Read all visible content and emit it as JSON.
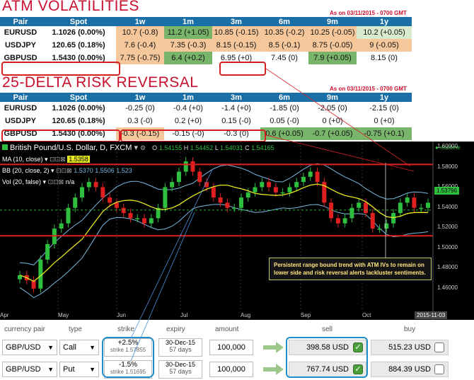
{
  "atm": {
    "title": "ATM VOLATILITIES",
    "asof": "As on 03/11/2015 - 0700 GMT",
    "headers": [
      "Pair",
      "Spot",
      "1w",
      "1m",
      "3m",
      "6m",
      "9m",
      "1y"
    ],
    "rows": [
      {
        "pair": "EURUSD",
        "spot": "1.1026 (0.00%)",
        "cells": [
          [
            "10.7 (-0.8)",
            "o"
          ],
          [
            "11.2 (+1.05)",
            "g"
          ],
          [
            "10.85 (-0.15)",
            "o"
          ],
          [
            "10.35 (-0.2)",
            "o"
          ],
          [
            "10.25 (-0.05)",
            "o"
          ],
          [
            "10.2 (+0.05)",
            "lg"
          ]
        ]
      },
      {
        "pair": "USDJPY",
        "spot": "120.65 (0.18%)",
        "cells": [
          [
            "7.6 (-0.4)",
            "o"
          ],
          [
            "7.35 (-0.3)",
            "o"
          ],
          [
            "8.15 (-0.15)",
            "o"
          ],
          [
            "8.5 (-0.1)",
            "o"
          ],
          [
            "8.75 (-0.05)",
            "o"
          ],
          [
            "9 (-0.05)",
            "o"
          ]
        ]
      },
      {
        "pair": "GBPUSD",
        "spot": "1.5430 (0.00%)",
        "cells": [
          [
            "7.75 (-0.75)",
            "o"
          ],
          [
            "6.4 (+0.2)",
            "g"
          ],
          [
            "6.95 (+0)",
            "w"
          ],
          [
            "7.45 (0)",
            "w"
          ],
          [
            "7.9 (+0.05)",
            "g"
          ],
          [
            "8.15 (0)",
            "w"
          ]
        ]
      }
    ]
  },
  "rr": {
    "title": "25-DELTA RISK REVERSAL",
    "asof": "As on 03/11/2015 - 0700 GMT",
    "headers": [
      "Pair",
      "Spot",
      "1w",
      "1m",
      "3m",
      "6m",
      "9m",
      "1y"
    ],
    "rows": [
      {
        "pair": "EURUSD",
        "spot": "1.1026 (0.00%)",
        "cells": [
          [
            "-0.25 (0)",
            "w"
          ],
          [
            "-0.4 (+0)",
            "w"
          ],
          [
            "-1.4 (+0)",
            "w"
          ],
          [
            "-1.85 (0)",
            "w"
          ],
          [
            "-2.05 (0)",
            "w"
          ],
          [
            "-2.15 (0)",
            "w"
          ]
        ]
      },
      {
        "pair": "USDJPY",
        "spot": "120.65 (0.18%)",
        "cells": [
          [
            "0.3 (-0)",
            "w"
          ],
          [
            "0.2 (+0)",
            "w"
          ],
          [
            "0.15 (-0)",
            "w"
          ],
          [
            "0.05 (-0)",
            "w"
          ],
          [
            "0 (+0)",
            "w"
          ],
          [
            "0 (+0)",
            "w"
          ]
        ]
      },
      {
        "pair": "GBPUSD",
        "spot": "1.5430 (0.00%)",
        "cells": [
          [
            "-0.3 (-0.15)",
            "o"
          ],
          [
            "-0.15 (-0)",
            "w"
          ],
          [
            "-0.3 (0)",
            "w"
          ],
          [
            "0.6 (+0.05)",
            "g"
          ],
          [
            "-0.7 (+0.05)",
            "g"
          ],
          [
            "-0.75 (+0.1)",
            "g"
          ]
        ]
      }
    ]
  },
  "chart": {
    "title": "British Pound/U.S. Dollar, D, FXCM",
    "ohlc": {
      "o_label": "O",
      "o": "1.54155",
      "h_label": "H",
      "h": "1.54452",
      "l_label": "L",
      "l": "1.54031",
      "c_label": "C",
      "c": "1.54165"
    },
    "realtime": "realtime",
    "ind1": "MA (10, close)",
    "ind1_val": "1.5358",
    "ind2": "BB (20, close, 2)",
    "ind2_vals": "1.5370  1.5506  1.523",
    "ind3": "Vol (20, false)",
    "ind3_val": "n/a",
    "yticks": [
      "1.60000",
      "1.58000",
      "1.56000",
      "1.54000",
      "1.52000",
      "1.50000",
      "1.48000",
      "1.46000"
    ],
    "last_price": "1.53796",
    "xticks": [
      "Apr",
      "May",
      "Jun",
      "Jul",
      "Aug",
      "Sep",
      "Oct"
    ],
    "date_label": "2015-11-03",
    "annotation": "Persistent range bound trend with ATM IVs to remain on lower side and risk reversal alerts lackluster sentiments."
  },
  "chart_data": {
    "type": "candlestick",
    "title": "British Pound/U.S. Dollar, D, FXCM",
    "x_range": [
      "Apr",
      "Nov"
    ],
    "y_range": [
      1.44,
      1.6
    ],
    "resistance": 1.582,
    "support": 1.513,
    "approx_closes": [
      1.475,
      1.47,
      1.462,
      1.49,
      1.505,
      1.52,
      1.525,
      1.54,
      1.55,
      1.56,
      1.565,
      1.56,
      1.55,
      1.545,
      1.54,
      1.535,
      1.53,
      1.53,
      1.525,
      1.53,
      1.54,
      1.56,
      1.565,
      1.575,
      1.585,
      1.575,
      1.565,
      1.56,
      1.55,
      1.545,
      1.54,
      1.54,
      1.55,
      1.555,
      1.56,
      1.565,
      1.56,
      1.555,
      1.555,
      1.56,
      1.565,
      1.57,
      1.575,
      1.565,
      1.545,
      1.53,
      1.525,
      1.53,
      1.54,
      1.545,
      1.535,
      1.52,
      1.52,
      1.525,
      1.535,
      1.545,
      1.55,
      1.54,
      1.54,
      1.545
    ]
  },
  "trade": {
    "headers": {
      "pair": "currency pair",
      "type": "type",
      "strike": "strike",
      "expiry": "expiry",
      "amount": "amount",
      "sell": "sell",
      "buy": "buy"
    },
    "rows": [
      {
        "pair": "GBP/USD",
        "type": "Call",
        "strike_pct": "+2.5%",
        "strike_val": "strike 1.57855",
        "expiry": "30-Dec-15",
        "days": "57 days",
        "amount": "100,000",
        "sell": "398.58 USD",
        "buy": "515.23 USD"
      },
      {
        "pair": "GBP/USD",
        "type": "Put",
        "strike_pct": "-1.5%",
        "strike_val": "strike 1.51695",
        "expiry": "30-Dec-15",
        "days": "57 days",
        "amount": "100,000",
        "sell": "767.74 USD",
        "buy": "884.39 USD"
      }
    ]
  },
  "colors": {
    "title_red": "#c8102e",
    "header_blue": "#1a6fa6",
    "bull": "#2fbf3f",
    "bear": "#e02020",
    "ma": "#e8e820",
    "bb": "#7ab8e0"
  }
}
